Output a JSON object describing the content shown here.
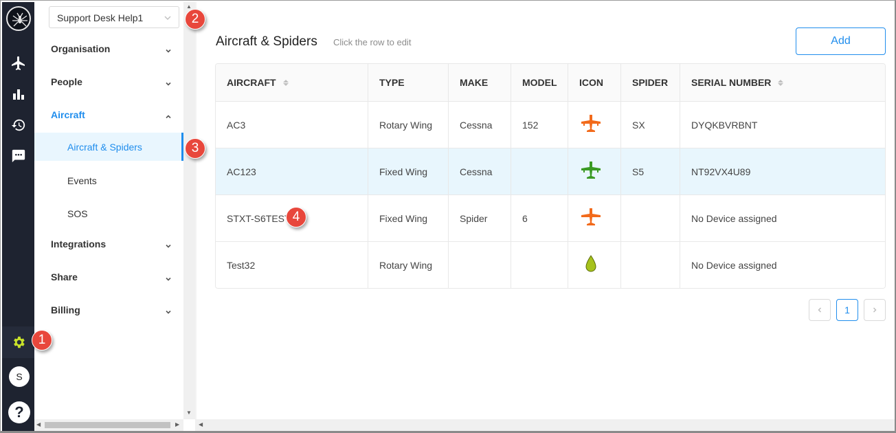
{
  "org_selector": {
    "value": "Support Desk Help1"
  },
  "sidebar": {
    "groups": [
      {
        "label": "Organisation"
      },
      {
        "label": "People"
      },
      {
        "label": "Aircraft"
      },
      {
        "label": "Integrations"
      },
      {
        "label": "Share"
      },
      {
        "label": "Billing"
      }
    ],
    "aircraft_items": [
      {
        "label": "Aircraft & Spiders"
      },
      {
        "label": "Events"
      },
      {
        "label": "SOS"
      }
    ]
  },
  "rail": {
    "avatar_initial": "S",
    "help_symbol": "?"
  },
  "main": {
    "title": "Aircraft & Spiders",
    "hint": "Click the row to edit",
    "add_label": "Add"
  },
  "table": {
    "columns": [
      "AIRCRAFT",
      "TYPE",
      "MAKE",
      "MODEL",
      "ICON",
      "SPIDER",
      "SERIAL NUMBER"
    ],
    "rows": [
      {
        "aircraft": "AC3",
        "type": "Rotary Wing",
        "make": "Cessna",
        "model": "152",
        "icon": "plane-icon",
        "icon_color": "#f26a1b",
        "spider": "SX",
        "serial": "DYQKBVRBNT"
      },
      {
        "aircraft": "AC123",
        "type": "Fixed Wing",
        "make": "Cessna",
        "model": "",
        "icon": "plane-icon",
        "icon_color": "#3a9a23",
        "spider": "S5",
        "serial": "NT92VX4U89"
      },
      {
        "aircraft": "STXT-S6TEST",
        "type": "Fixed Wing",
        "make": "Spider",
        "model": "6",
        "icon": "plane-icon",
        "icon_color": "#f26a1b",
        "spider": "",
        "serial": "No Device assigned"
      },
      {
        "aircraft": "Test32",
        "type": "Rotary Wing",
        "make": "",
        "model": "",
        "icon": "drop-icon",
        "icon_color": "#a6c21c",
        "spider": "",
        "serial": "No Device assigned"
      }
    ]
  },
  "pagination": {
    "current": "1"
  },
  "callouts": [
    "1",
    "2",
    "3",
    "4"
  ],
  "colors": {
    "accent": "#1f8ded",
    "rail": "#1e2330",
    "callout": "#e8473c",
    "settings_icon": "#c9e22a"
  }
}
